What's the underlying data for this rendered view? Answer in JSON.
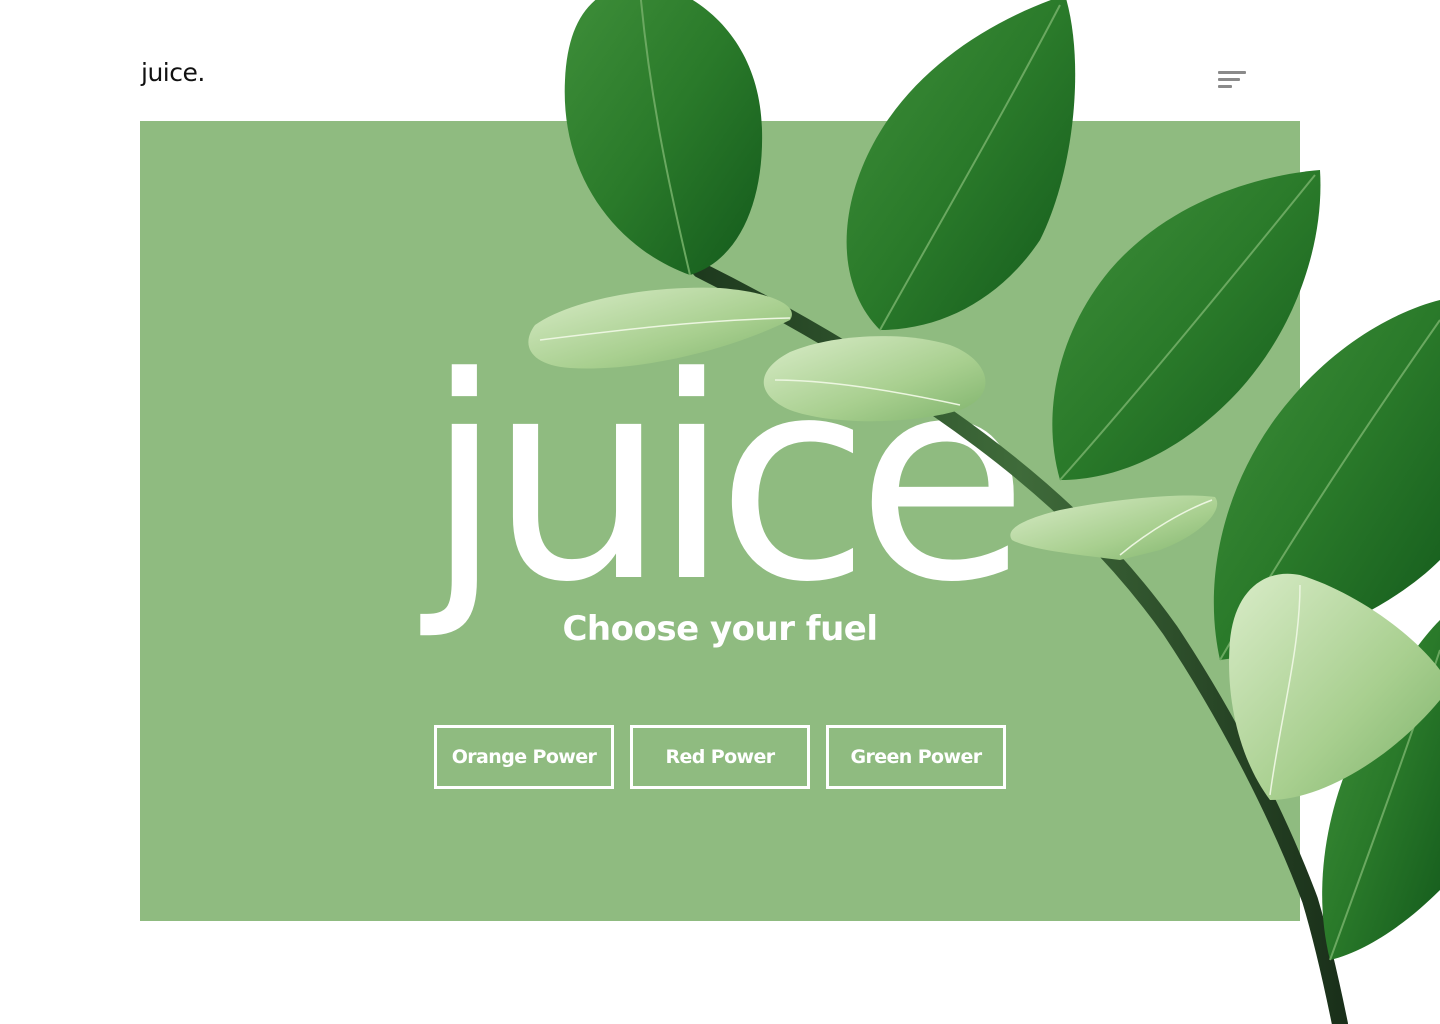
{
  "header": {
    "logo_text": "juice.",
    "menu_icon": "hamburger-menu-icon"
  },
  "hero": {
    "big_word": "juice",
    "tagline": "Choose your fuel",
    "background_color": "#8fbb80",
    "buttons": [
      {
        "label": "Orange Power"
      },
      {
        "label": "Red Power"
      },
      {
        "label": "Green Power"
      }
    ]
  },
  "decoration": {
    "image": "green-leaf-branch"
  },
  "colors": {
    "accent": "#8fbb80",
    "text_light": "#ffffff",
    "text_dark": "#111111"
  }
}
